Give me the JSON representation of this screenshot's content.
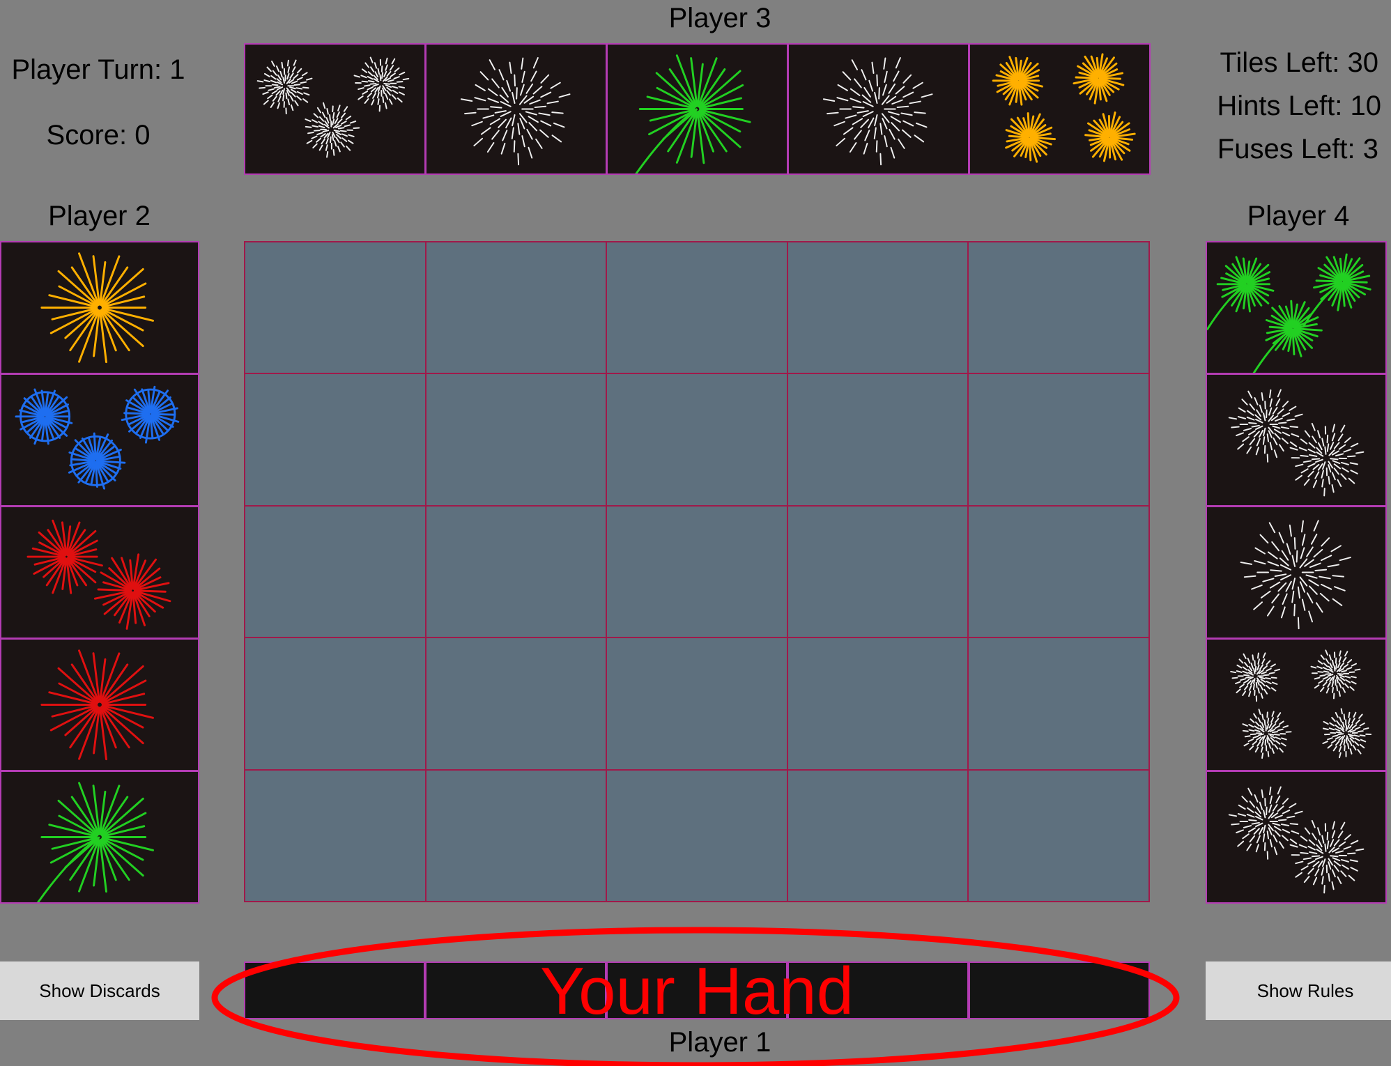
{
  "status": {
    "player_turn": "Player Turn: 1",
    "score": "Score: 0",
    "tiles_left": "Tiles Left: 30",
    "hints_left": "Hints Left: 10",
    "fuses_left": "Fuses Left: 3"
  },
  "players": {
    "p1": "Player 1",
    "p2": "Player 2",
    "p3": "Player 3",
    "p4": "Player 4"
  },
  "cards": {
    "player3": [
      {
        "color": "white",
        "count": 3
      },
      {
        "color": "white",
        "count": 1
      },
      {
        "color": "green",
        "count": 1
      },
      {
        "color": "white",
        "count": 1
      },
      {
        "color": "yellow",
        "count": 4
      }
    ],
    "player2": [
      {
        "color": "yellow",
        "count": 1
      },
      {
        "color": "blue",
        "count": 3
      },
      {
        "color": "red",
        "count": 2
      },
      {
        "color": "red",
        "count": 1
      },
      {
        "color": "green",
        "count": 1
      }
    ],
    "player4": [
      {
        "color": "green",
        "count": 3
      },
      {
        "color": "white",
        "count": 2
      },
      {
        "color": "white",
        "count": 1
      },
      {
        "color": "white",
        "count": 4
      },
      {
        "color": "white",
        "count": 2
      }
    ]
  },
  "colors": {
    "white": "#f0f0f0",
    "yellow": "#ffb000",
    "green": "#22d022",
    "red": "#e01010",
    "blue": "#1e6ef0",
    "board_cell": "#5e707e",
    "tile_border": "#b43cb4",
    "hand_marker": "#ff0000"
  },
  "hand": {
    "label": "Your Hand"
  },
  "buttons": {
    "show_discards": "Show Discards",
    "show_rules": "Show Rules"
  }
}
